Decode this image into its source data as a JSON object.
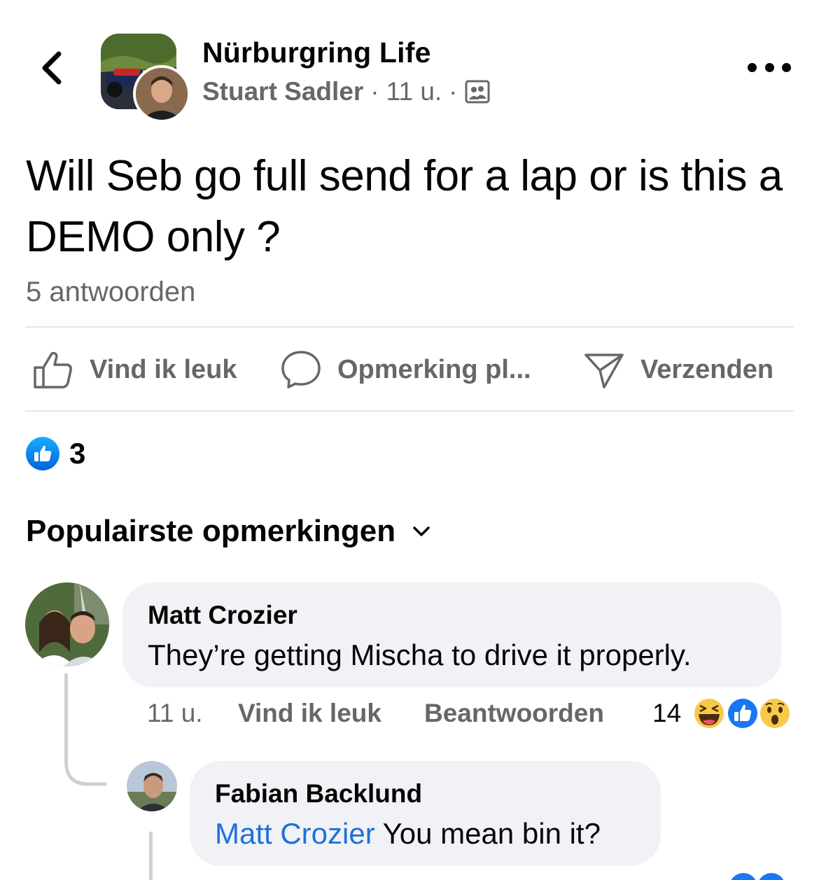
{
  "header": {
    "group_name": "Nürburgring Life",
    "author": "Stuart Sadler",
    "time": "11 u.",
    "separator": "·",
    "icons": {
      "back": "chevron-left-icon",
      "audience": "group-members-icon",
      "more": "more-dots-icon"
    }
  },
  "post": {
    "text": "Will Seb go full send for a lap or is this a DEMO only ?",
    "replies_count": "5 antwoorden"
  },
  "actions": {
    "like_label": "Vind ik leuk",
    "comment_label": "Opmerking pl...",
    "send_label": "Verzenden"
  },
  "reactions": {
    "count": "3"
  },
  "sort": {
    "label": "Populairste opmerkingen"
  },
  "comments": [
    {
      "name": "Matt Crozier",
      "text": "They’re getting Mischa to drive it properly.",
      "time": "11 u.",
      "like_label": "Vind ik leuk",
      "reply_label": "Beantwoorden",
      "reaction_count": "14",
      "reaction_icons": [
        "laugh-reaction-icon",
        "like-reaction-icon",
        "wow-reaction-icon"
      ]
    },
    {
      "name": "Fabian Backlund",
      "mention": "Matt Crozier",
      "text": " You mean bin it?"
    }
  ],
  "colors": {
    "accent": "#216fdb",
    "like_blue": "#0866ff",
    "muted": "#65676b",
    "bubble": "#f0f2f5"
  }
}
